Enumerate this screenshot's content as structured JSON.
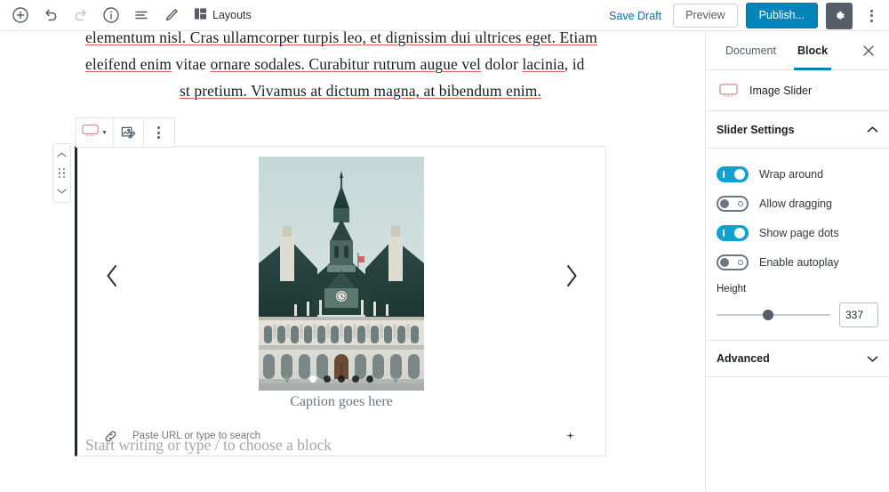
{
  "topbar": {
    "add_block": "Add block",
    "undo": "Undo",
    "redo": "Redo",
    "info": "Content structure",
    "list_view": "Block navigation",
    "edit": "Edit",
    "layouts_label": "Layouts",
    "save_draft": "Save Draft",
    "preview": "Preview",
    "publish": "Publish...",
    "settings": "Settings",
    "more": "More tools & options"
  },
  "document": {
    "paragraph_line1": "elementum nisl. Cras ullamcorper turpis leo, et dignissim dui ultrices eget. Etiam",
    "paragraph_line2_a": "eleifend enim",
    "paragraph_line2_b": " vitae ",
    "paragraph_line2_c": "ornare sodales",
    "paragraph_line2_d": ". Curabitur rutrum augue vel",
    "paragraph_line2_e": " dolor ",
    "paragraph_line2_f": "lacinia",
    "paragraph_line2_g": ", id",
    "paragraph_line3": "st pretium. Vivamus at dictum magna, at bibendum enim.",
    "placeholder": "Start writing or type / to choose a block"
  },
  "block_toolbar": {
    "block_type": "Image Slider block type",
    "edit_media": "Edit media",
    "more_options": "More options"
  },
  "mover": {
    "move_up": "Move up",
    "drag": "Drag block",
    "move_down": "Move down"
  },
  "slider_block": {
    "prev_label": "Previous slide",
    "next_label": "Next slide",
    "caption": "Caption goes here",
    "url_placeholder": "Paste URL or type to search",
    "url_value": "",
    "dots": [
      {
        "active": true
      },
      {
        "active": false
      },
      {
        "active": false
      },
      {
        "active": false
      },
      {
        "active": false
      }
    ],
    "image_alt": "Historic city hall building with ornate stone facade and teal roof"
  },
  "sidebar": {
    "tabs": [
      {
        "label": "Document",
        "active": false
      },
      {
        "label": "Block",
        "active": true
      }
    ],
    "close_label": "Close settings",
    "block_card": {
      "icon": "image-slider-icon",
      "title": "Image Slider"
    },
    "panels": [
      {
        "title": "Slider Settings",
        "expanded": true
      },
      {
        "title": "Advanced",
        "expanded": false
      }
    ],
    "toggles": [
      {
        "label": "Wrap around",
        "on": true
      },
      {
        "label": "Allow dragging",
        "on": false
      },
      {
        "label": "Show page dots",
        "on": true
      },
      {
        "label": "Enable autoplay",
        "on": false
      }
    ],
    "height_field": {
      "label": "Height",
      "value": "337",
      "slider_percent": 45
    }
  },
  "colors": {
    "accent_blue": "#0085ba",
    "toggle_on": "#11a0d2",
    "link_blue": "#0073aa",
    "gear_bg": "#555d66",
    "selected_border": "#23282d",
    "spellcheck": "#e05a5a",
    "slider_icon": "#d0868b"
  }
}
